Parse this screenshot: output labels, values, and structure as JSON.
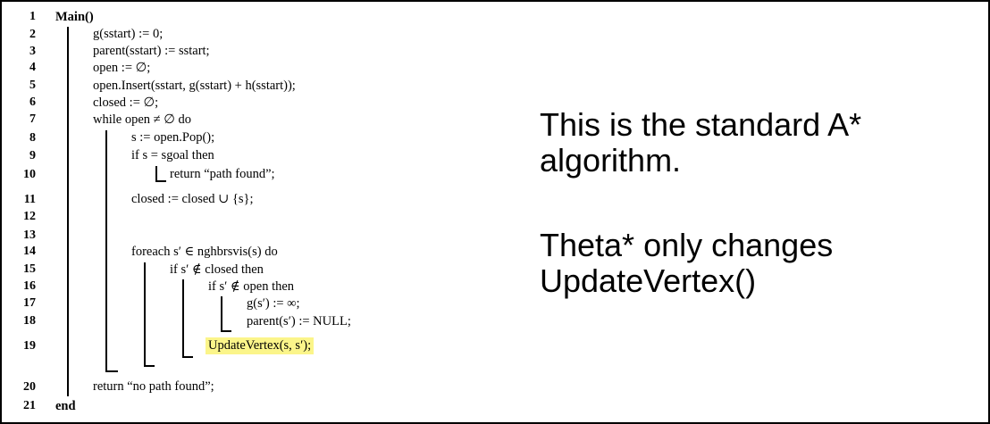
{
  "algorithm": {
    "line_numbers": [
      "1",
      "2",
      "3",
      "4",
      "5",
      "6",
      "7",
      "8",
      "9",
      "10",
      "11",
      "12",
      "13",
      "14",
      "15",
      "16",
      "17",
      "18",
      "19",
      "20",
      "21"
    ],
    "lines": {
      "l1": "Main()",
      "l2": "g(sstart) := 0;",
      "l3": "parent(sstart) := sstart;",
      "l4": "open := ∅;",
      "l5": "open.Insert(sstart, g(sstart) + h(sstart));",
      "l6": "closed := ∅;",
      "l7": "while open ≠ ∅ do",
      "l8": "s := open.Pop();",
      "l9": "if s = sgoal then",
      "l10": "return “path found”;",
      "l11": "closed := closed ∪ {s};",
      "l14": "foreach s′ ∈ nghbrsvis(s) do",
      "l15": "if s′ ∉ closed then",
      "l16": "if s′ ∉ open then",
      "l17": "g(s′) := ∞;",
      "l18": "parent(s′) := NULL;",
      "l19": "UpdateVertex(s, s′);",
      "l20": "return “no path found”;",
      "l21": "end"
    },
    "highlight_color": "#fbf58a"
  },
  "notes": {
    "note1_line1": "This is the standard A*",
    "note1_line2": "algorithm.",
    "note2_line1": "Theta* only changes",
    "note2_line2": "UpdateVertex()"
  }
}
